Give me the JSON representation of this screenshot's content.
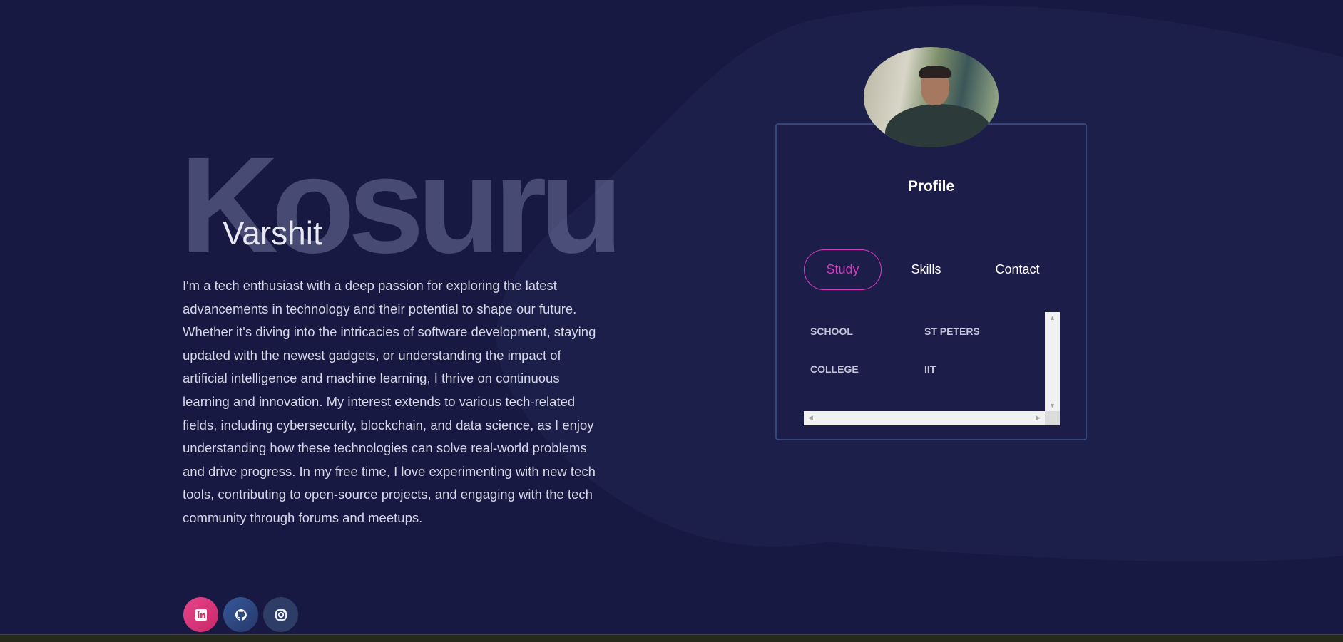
{
  "hero": {
    "last_name": "Kosuru",
    "first_name": "Varshit",
    "about": "I'm a tech enthusiast with a deep passion for exploring the latest advancements in technology and their potential to shape our future. Whether it's diving into the intricacies of software development, staying updated with the newest gadgets, or understanding the impact of artificial intelligence and machine learning, I thrive on continuous learning and innovation. My interest extends to various tech-related fields, including cybersecurity, blockchain, and data science, as I enjoy understanding how these technologies can solve real-world problems and drive progress. In my free time, I love experimenting with new tech tools, contributing to open-source projects, and engaging with the tech community through forums and meetups."
  },
  "socials": [
    {
      "icon": "linkedin-icon",
      "color": "#d9306f"
    },
    {
      "icon": "github-icon",
      "color": "#2f4a80"
    },
    {
      "icon": "instagram-icon",
      "color": "#2e3d66"
    }
  ],
  "profile": {
    "title": "Profile",
    "tabs": [
      {
        "label": "Study",
        "active": true
      },
      {
        "label": "Skills",
        "active": false
      },
      {
        "label": "Contact",
        "active": false
      }
    ],
    "study_rows": [
      {
        "key": "SCHOOL",
        "value": "ST PETERS"
      },
      {
        "key": "COLLEGE",
        "value": "IIT"
      }
    ]
  },
  "colors": {
    "background": "#171943",
    "accent": "#d63bbf",
    "card_border": "#34467a"
  }
}
